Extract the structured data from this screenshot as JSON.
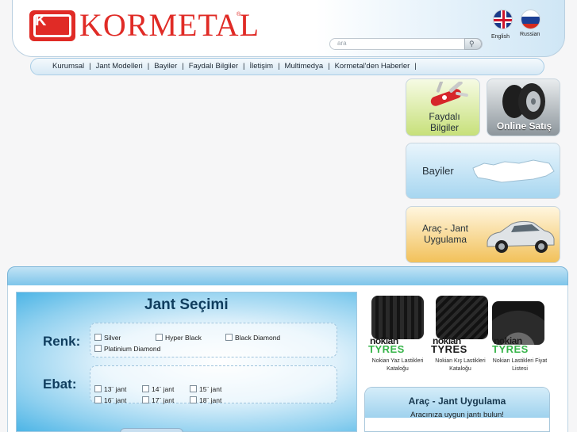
{
  "header": {
    "logo_text": "KORMETAL",
    "logo_mark": "K",
    "registered": "®",
    "search_placeholder": "ara",
    "search_button_icon": "magnifier-icon",
    "languages": [
      {
        "label": "English",
        "flag": "uk-flag-icon"
      },
      {
        "label": "Russian",
        "flag": "russia-flag-icon"
      }
    ]
  },
  "nav": {
    "items": [
      "Kurumsal",
      "Jant Modelleri",
      "Bayiler",
      "Faydalı Bilgiler",
      "İletişim",
      "Multimedya",
      "Kormetal'den Haberler"
    ],
    "separator": "|"
  },
  "tiles": {
    "faydali": "Faydalı\nBilgiler",
    "online": "Online Satış",
    "bayiler": "Bayiler",
    "arac": "Araç - Jant\nUygulama"
  },
  "jant_secimi": {
    "title": "Jant Seçimi",
    "renk_label": "Renk:",
    "colors": [
      "Silver",
      "Hyper Black",
      "Black Diamond",
      "Platinium Diamond"
    ],
    "ebat_label": "Ebat:",
    "sizes": [
      "13¨ jant",
      "14¨ jant",
      "15¨ jant",
      "16¨ jant",
      "17¨ jant",
      "18¨ jant"
    ]
  },
  "nokian": [
    {
      "brand": "nokian",
      "word": "TYRES",
      "caption": "Nokian Yaz Lastikleri\nKataloğu",
      "title": "Yaz Lastikleri Kataloğu"
    },
    {
      "brand": "nokian",
      "word": "TYRES",
      "caption": "Nokian Kış Lastikleri\nKataloğu",
      "title": "Kış Lastikleri Kataloğu"
    },
    {
      "brand": "nokian",
      "word": "TYRES",
      "caption": "Nokian Lastikleri Fiyat\nListesi",
      "title": "Nokian Lastikleri Fiyat Listesi"
    }
  ],
  "arac_jant": {
    "title": "Araç - Jant Uygulama",
    "subtitle": "Aracınıza uygun jantı bulun!"
  },
  "colors": {
    "brand_red": "#e02b26",
    "accent_blue": "#7ec5ea",
    "nokian_green": "#36b449"
  }
}
